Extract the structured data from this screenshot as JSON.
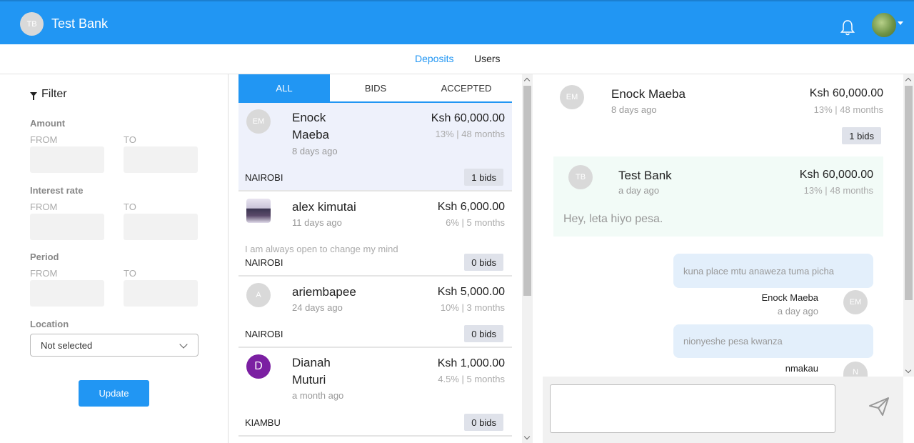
{
  "header": {
    "brand_initials": "TB",
    "brand_name": "Test Bank",
    "notifications_icon": "bell-icon",
    "avatar_icon": "user-avatar-icon",
    "accent_color": "#2196f3"
  },
  "nav": {
    "items": [
      {
        "label": "Deposits",
        "active": true
      },
      {
        "label": "Users",
        "active": false
      }
    ]
  },
  "filter": {
    "title": "Filter",
    "amount": {
      "label": "Amount",
      "from": "FROM",
      "to": "TO"
    },
    "interest": {
      "label": "Interest rate",
      "from": "FROM",
      "to": "TO"
    },
    "period": {
      "label": "Period",
      "from": "FROM",
      "to": "TO"
    },
    "location": {
      "label": "Location",
      "value": "Not selected"
    },
    "update_label": "Update"
  },
  "tabs": [
    {
      "label": "ALL",
      "active": true
    },
    {
      "label": "BIDS",
      "active": false
    },
    {
      "label": "ACCEPTED",
      "active": false
    }
  ],
  "deposits": [
    {
      "initials": "EM",
      "name_line1": "Enock",
      "name_line2": "Maeba",
      "ago": "8 days ago",
      "amount": "Ksh 60,000.00",
      "terms": "13% | 48 months",
      "location": "NAIROBI",
      "bids": "1 bids",
      "message": ""
    },
    {
      "initials": "",
      "name_line1": "alex kimutai",
      "name_line2": "",
      "ago": "11 days ago",
      "amount": "Ksh 6,000.00",
      "terms": "6% | 5 months",
      "location": "NAIROBI",
      "bids": "0 bids",
      "message": "I am always open to change my mind"
    },
    {
      "initials": "A",
      "name_line1": "ariembapee",
      "name_line2": "",
      "ago": "24 days ago",
      "amount": "Ksh 5,000.00",
      "terms": "10% | 3 months",
      "location": "NAIROBI",
      "bids": "0 bids",
      "message": ""
    },
    {
      "initials": "D",
      "name_line1": "Dianah",
      "name_line2": "Muturi",
      "ago": "a month ago",
      "amount": "Ksh 1,000.00",
      "terms": "4.5% | 5 months",
      "location": "KIAMBU",
      "bids": "0 bids",
      "message": ""
    }
  ],
  "detail": {
    "initials": "EM",
    "name": "Enock Maeba",
    "ago": "8 days ago",
    "amount": "Ksh 60,000.00",
    "terms": "13% | 48 months",
    "bids": "1 bids",
    "bid": {
      "initials": "TB",
      "name": "Test Bank",
      "ago": "a day ago",
      "amount": "Ksh 60,000.00",
      "terms": "13% | 48 months",
      "message": "Hey, leta hiyo pesa."
    },
    "chat": [
      {
        "text": "kuna place mtu anaweza tuma picha",
        "author": "Enock Maeba",
        "ago": "a day ago",
        "initials": "EM"
      },
      {
        "text": "nionyeshe pesa kwanza",
        "author": "nmakau",
        "ago": "",
        "initials": "N"
      }
    ],
    "send_icon": "send-icon"
  }
}
